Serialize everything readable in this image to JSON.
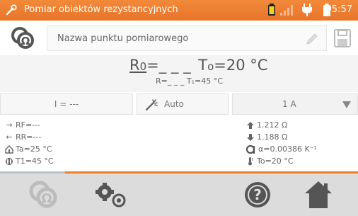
{
  "status": {
    "title": "Pomiar obiektów rezystancyjnych",
    "time": "05:57"
  },
  "name_field": {
    "placeholder": "Nazwa punktu pomiarowego"
  },
  "result": {
    "main_label": "R",
    "main_sub": "0",
    "main_eq": "=_ _ _",
    "temp_label": "T",
    "temp_sub": "o",
    "temp_value": "=20 °C",
    "secondary": "R=_ _ _ T₁=45 °C"
  },
  "controls": {
    "current": "I = ---",
    "mode": "Auto",
    "range": "1 A"
  },
  "params_left": [
    {
      "icon": "arrow-right-icon",
      "symbol": "→",
      "text": "RF=---"
    },
    {
      "icon": "arrow-left-icon",
      "symbol": "←",
      "text": "RR=---"
    },
    {
      "icon": "house-temp-icon",
      "symbol": "⌂",
      "text": "Ta=25 °C"
    },
    {
      "icon": "coil-temp-icon",
      "symbol": "",
      "text": "T1=45 °C"
    }
  ],
  "params_right": [
    {
      "icon": "cable-up-icon",
      "text": "1.212 Ω"
    },
    {
      "icon": "cable-down-icon",
      "text": "1.188 Ω"
    },
    {
      "icon": "alpha-icon",
      "symbol": "α",
      "text": "α=0.00386 K⁻¹"
    },
    {
      "icon": "thermometer-icon",
      "text": "To=20 °C"
    }
  ],
  "colors": {
    "accent": "#ee7f2d",
    "status_bar": "#ec7e30",
    "bottom_bar": "#dcdcdc",
    "icon_dark": "#555555",
    "icon_disabled": "#bcbcbc"
  }
}
